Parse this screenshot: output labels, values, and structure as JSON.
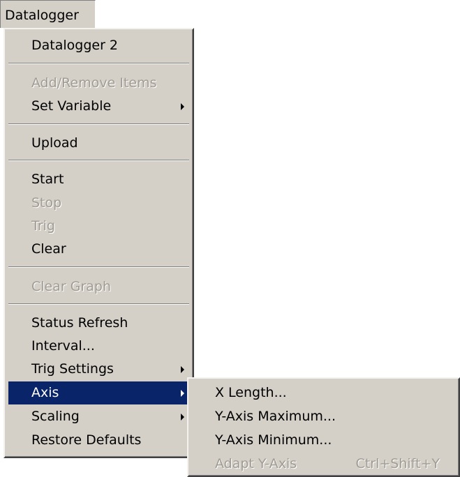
{
  "menubar": {
    "title": "Datalogger"
  },
  "menu": {
    "items": [
      {
        "label": "Datalogger 2"
      },
      {
        "label": "Add/Remove Items",
        "disabled": true
      },
      {
        "label": "Set Variable",
        "submenu": true
      },
      {
        "label": "Upload"
      },
      {
        "label": "Start"
      },
      {
        "label": "Stop",
        "disabled": true
      },
      {
        "label": "Trig",
        "disabled": true
      },
      {
        "label": "Clear"
      },
      {
        "label": "Clear Graph",
        "disabled": true
      },
      {
        "label": "Status Refresh"
      },
      {
        "label": "Interval..."
      },
      {
        "label": "Trig Settings",
        "submenu": true
      },
      {
        "label": "Axis",
        "submenu": true,
        "highlighted": true
      },
      {
        "label": "Scaling",
        "submenu": true
      },
      {
        "label": "Restore Defaults"
      }
    ]
  },
  "submenu": {
    "items": [
      {
        "label": "X Length..."
      },
      {
        "label": "Y-Axis Maximum..."
      },
      {
        "label": "Y-Axis Minimum..."
      },
      {
        "label": "Adapt Y-Axis",
        "shortcut": "Ctrl+Shift+Y",
        "disabled": true
      }
    ]
  },
  "colors": {
    "menu_bg": "#d4d0c8",
    "highlight_bg": "#0a246a",
    "disabled_text": "#a09c94"
  }
}
